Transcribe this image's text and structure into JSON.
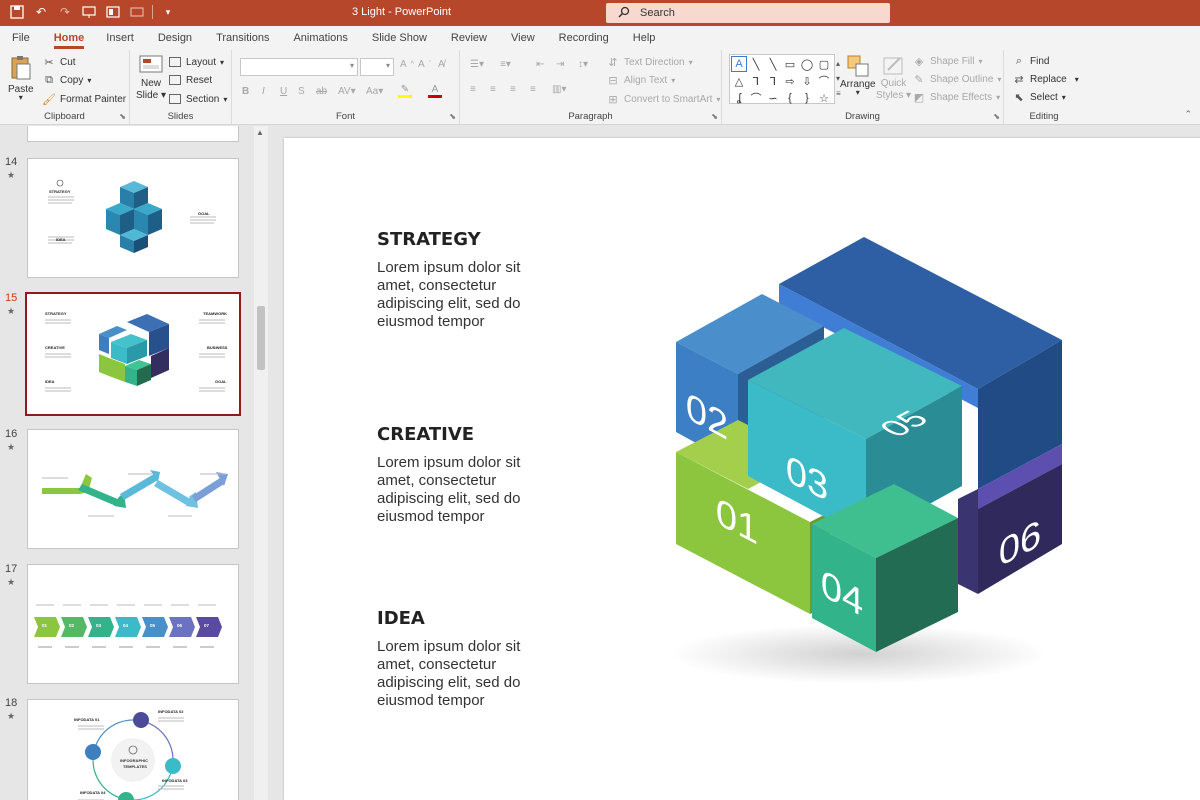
{
  "titlebar": {
    "title": "3 Light  -  PowerPoint",
    "search_placeholder": "Search"
  },
  "tabs": [
    "File",
    "Home",
    "Insert",
    "Design",
    "Transitions",
    "Animations",
    "Slide Show",
    "Review",
    "View",
    "Recording",
    "Help"
  ],
  "ribbon": {
    "clipboard": {
      "label": "Clipboard",
      "paste": "Paste",
      "cut": "Cut",
      "copy": "Copy",
      "format_painter": "Format Painter"
    },
    "slides": {
      "label": "Slides",
      "new_slide_1": "New",
      "new_slide_2": "Slide",
      "layout": "Layout",
      "reset": "Reset",
      "section": "Section"
    },
    "font": {
      "label": "Font"
    },
    "paragraph": {
      "label": "Paragraph",
      "text_direction": "Text Direction",
      "align_text": "Align Text",
      "convert_smartart": "Convert to SmartArt"
    },
    "drawing": {
      "label": "Drawing",
      "arrange": "Arrange",
      "quick_styles_1": "Quick",
      "quick_styles_2": "Styles",
      "shape_fill": "Shape Fill",
      "shape_outline": "Shape Outline",
      "shape_effects": "Shape Effects"
    },
    "editing": {
      "label": "Editing",
      "find": "Find",
      "replace": "Replace",
      "select": "Select"
    }
  },
  "slides_panel": {
    "numbers": [
      "14",
      "15",
      "16",
      "17",
      "18"
    ],
    "thumb14": {
      "strategy": "STRATEGY",
      "goal": "GOAL",
      "idea": "IDEA"
    },
    "thumb15": {
      "strategy": "STRATEGY",
      "teamwork": "TEAMWORK",
      "creative": "CREATIVE",
      "business": "BUSINESS",
      "idea": "IDEA",
      "goal": "GOAL"
    },
    "thumb17_nums": [
      "01",
      "02",
      "03",
      "04",
      "05",
      "06",
      "07"
    ],
    "thumb18": {
      "infodata01": "INFODATA 01",
      "infodata02": "INFODATA 02",
      "infodata03": "INFODATA 03",
      "infodata04": "INFODATA 04",
      "center_1": "INFOGRAPHIC",
      "center_2": "TEMPLATES"
    }
  },
  "slide": {
    "blocks": [
      {
        "title": "STRATEGY",
        "text": "Lorem ipsum dolor sit amet, consectetur adipiscing elit, sed do eiusmod tempor"
      },
      {
        "title": "CREATIVE",
        "text": "Lorem ipsum dolor sit amet, consectetur adipiscing elit, sed do eiusmod tempor"
      },
      {
        "title": "IDEA",
        "text": "Lorem ipsum dolor sit amet, consectetur adipiscing elit, sed do eiusmod tempor"
      }
    ],
    "cube_labels": [
      "01",
      "02",
      "03",
      "04",
      "05",
      "06"
    ]
  },
  "colors": {
    "accent": "#b7472a",
    "green": "#8cc63f",
    "teal": "#3bbac8",
    "blue": "#3d7fbf",
    "navy": "#2d5a9c",
    "purple": "#332d60",
    "emerald": "#32b38a"
  }
}
